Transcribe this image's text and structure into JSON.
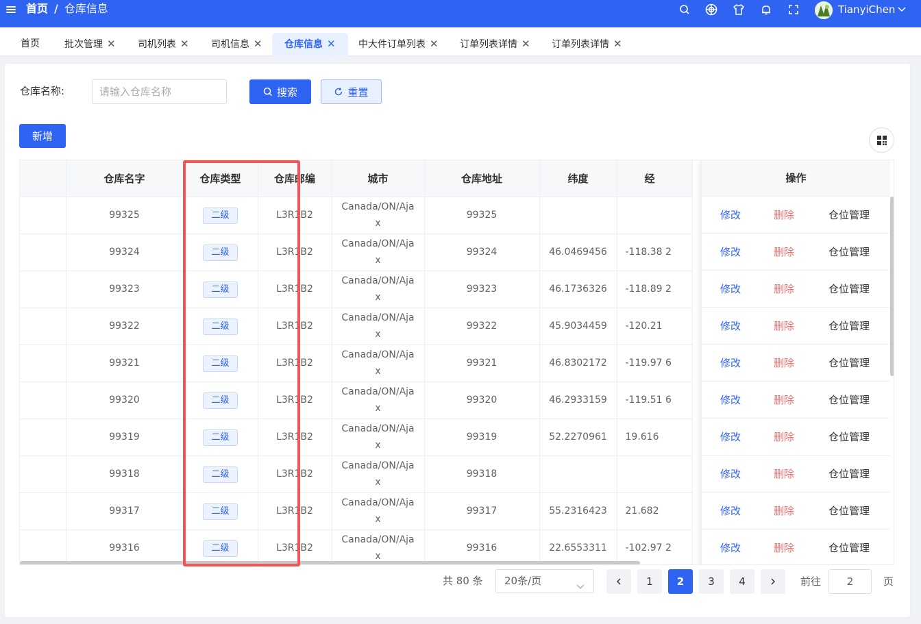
{
  "header": {
    "breadcrumb_home": "首页",
    "breadcrumb_sep": "/",
    "breadcrumb_current": "仓库信息",
    "username": "TianyiChen"
  },
  "tabs": [
    {
      "label": "首页"
    },
    {
      "label": "批次管理"
    },
    {
      "label": "司机列表"
    },
    {
      "label": "司机信息"
    },
    {
      "label": "仓库信息"
    },
    {
      "label": "中大件订单列表"
    },
    {
      "label": "订单列表详情"
    },
    {
      "label": "订单列表详情"
    }
  ],
  "active_tab_index": 4,
  "search": {
    "label": "仓库名称:",
    "placeholder": "请输入仓库名称",
    "value": "",
    "search_button": "搜索",
    "reset_button": "重置"
  },
  "toolbar": {
    "add_button": "新增"
  },
  "table": {
    "headers": {
      "name": "仓库名字",
      "type": "仓库类型",
      "zip": "仓库邮编",
      "city": "城市",
      "address": "仓库地址",
      "lat": "纬度",
      "lng": "经",
      "ops": "操作"
    },
    "rows": [
      {
        "name": "99325",
        "type": "二级",
        "zip": "L3R1B2",
        "city": "Canada/ON/Ajax",
        "address": "99325",
        "lat": "",
        "lng": ""
      },
      {
        "name": "99324",
        "type": "二级",
        "zip": "L3R1B2",
        "city": "Canada/ON/Ajax",
        "address": "99324",
        "lat": "46.0469456",
        "lng": "-118.38 2"
      },
      {
        "name": "99323",
        "type": "二级",
        "zip": "L3R1B2",
        "city": "Canada/ON/Ajax",
        "address": "99323",
        "lat": "46.1736326",
        "lng": "-118.89 2"
      },
      {
        "name": "99322",
        "type": "二级",
        "zip": "L3R1B2",
        "city": "Canada/ON/Ajax",
        "address": "99322",
        "lat": "45.9034459",
        "lng": "-120.21"
      },
      {
        "name": "99321",
        "type": "二级",
        "zip": "L3R1B2",
        "city": "Canada/ON/Ajax",
        "address": "99321",
        "lat": "46.8302172",
        "lng": "-119.97 6"
      },
      {
        "name": "99320",
        "type": "二级",
        "zip": "L3R1B2",
        "city": "Canada/ON/Ajax",
        "address": "99320",
        "lat": "46.2933159",
        "lng": "-119.51 6"
      },
      {
        "name": "99319",
        "type": "二级",
        "zip": "L3R1B2",
        "city": "Canada/ON/Ajax",
        "address": "99319",
        "lat": "52.2270961",
        "lng": "19.616"
      },
      {
        "name": "99318",
        "type": "二级",
        "zip": "L3R1B2",
        "city": "Canada/ON/Ajax",
        "address": "99318",
        "lat": "",
        "lng": ""
      },
      {
        "name": "99317",
        "type": "二级",
        "zip": "L3R1B2",
        "city": "Canada/ON/Ajax",
        "address": "99317",
        "lat": "55.2316423",
        "lng": "21.682"
      },
      {
        "name": "99316",
        "type": "二级",
        "zip": "L3R1B2",
        "city": "Canada/ON/Ajax",
        "address": "99316",
        "lat": "22.6553311",
        "lng": "-102.97 2"
      }
    ],
    "ops": {
      "edit": "修改",
      "delete": "删除",
      "location": "仓位管理"
    }
  },
  "pagination": {
    "total": "共 80 条",
    "page_size": "20条/页",
    "pages": [
      "1",
      "2",
      "3",
      "4"
    ],
    "current_page": "2",
    "goto_label": "前往",
    "goto_value": "2",
    "goto_suffix": "页"
  },
  "colors": {
    "primary": "#2f63f2",
    "danger": "#f56c6c",
    "highlight_box": "#f25557"
  }
}
